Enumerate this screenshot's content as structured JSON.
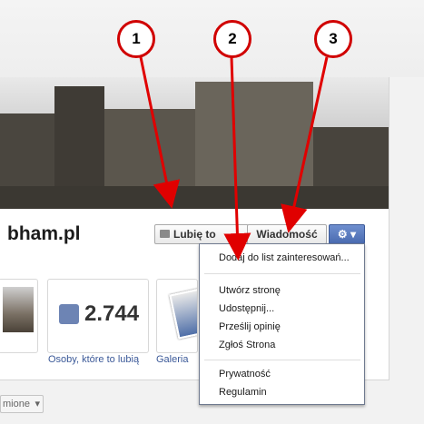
{
  "page": {
    "name": "bham.pl"
  },
  "actions": {
    "like_label": "Lubię to",
    "message_label": "Wiadomość",
    "gear_caret": "▾"
  },
  "stats": {
    "likes_count": "2.744",
    "likes_caption": "Osoby, które to lubią",
    "gallery_caption": "Galeria"
  },
  "bottom_dropdown": {
    "value": "mione"
  },
  "menu": {
    "items": [
      "Dodaj do list zainteresowań...",
      "Utwórz stronę",
      "Udostępnij...",
      "Prześlij opinię",
      "Zgłoś Strona",
      "Prywatność",
      "Regulamin"
    ]
  },
  "markers": [
    "1",
    "2",
    "3"
  ],
  "colors": {
    "marker_red": "#d00000",
    "brand_blue": "#3b5998"
  },
  "icons": {
    "like": "thumbs-up-icon",
    "gear": "gear-icon",
    "caret": "chevron-down-icon"
  }
}
